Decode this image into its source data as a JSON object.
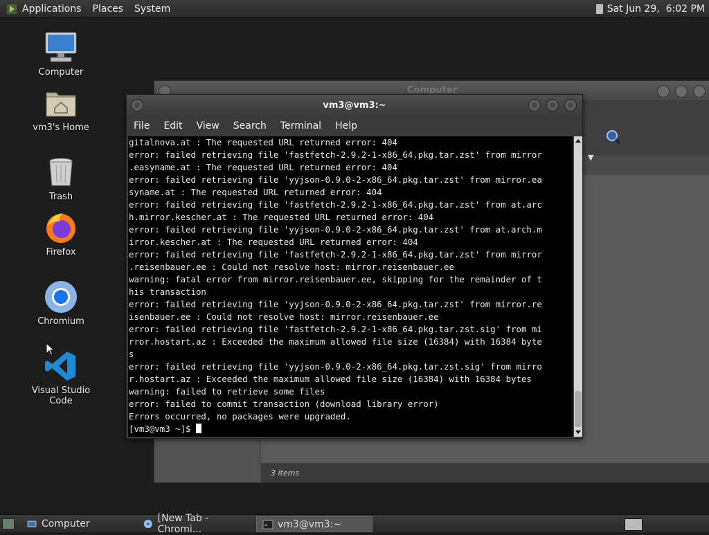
{
  "top_panel": {
    "menus": [
      "Applications",
      "Places",
      "System"
    ],
    "clock": "Sat Jun 29,  6:02 PM"
  },
  "desktop": {
    "icons": [
      {
        "label": "Computer",
        "icon": "computer-icon"
      },
      {
        "label": "vm3's Home",
        "icon": "home-folder-icon"
      },
      {
        "label": "Trash",
        "icon": "trash-icon"
      },
      {
        "label": "Firefox",
        "icon": "firefox-icon"
      },
      {
        "label": "Chromium",
        "icon": "chromium-icon"
      },
      {
        "label": "Visual Studio Code",
        "icon": "vscode-icon"
      }
    ]
  },
  "file_manager": {
    "title": "Computer",
    "status": "3 items"
  },
  "terminal": {
    "title": "vm3@vm3:~",
    "menus": [
      "File",
      "Edit",
      "View",
      "Search",
      "Terminal",
      "Help"
    ],
    "lines": [
      "gitalnova.at : The requested URL returned error: 404",
      "error: failed retrieving file 'fastfetch-2.9.2-1-x86_64.pkg.tar.zst' from mirror",
      ".easyname.at : The requested URL returned error: 404",
      "error: failed retrieving file 'yyjson-0.9.0-2-x86_64.pkg.tar.zst' from mirror.ea",
      "syname.at : The requested URL returned error: 404",
      "error: failed retrieving file 'fastfetch-2.9.2-1-x86_64.pkg.tar.zst' from at.arc",
      "h.mirror.kescher.at : The requested URL returned error: 404",
      "error: failed retrieving file 'yyjson-0.9.0-2-x86_64.pkg.tar.zst' from at.arch.m",
      "irror.kescher.at : The requested URL returned error: 404",
      "error: failed retrieving file 'fastfetch-2.9.2-1-x86_64.pkg.tar.zst' from mirror",
      ".reisenbauer.ee : Could not resolve host: mirror.reisenbauer.ee",
      "warning: fatal error from mirror.reisenbauer.ee, skipping for the remainder of t",
      "his transaction",
      "error: failed retrieving file 'yyjson-0.9.0-2-x86_64.pkg.tar.zst' from mirror.re",
      "isenbauer.ee : Could not resolve host: mirror.reisenbauer.ee",
      "error: failed retrieving file 'fastfetch-2.9.2-1-x86_64.pkg.tar.zst.sig' from mi",
      "rror.hostart.az : Exceeded the maximum allowed file size (16384) with 16384 byte",
      "s",
      "error: failed retrieving file 'yyjson-0.9.0-2-x86_64.pkg.tar.zst.sig' from mirro",
      "r.hostart.az : Exceeded the maximum allowed file size (16384) with 16384 bytes",
      "warning: failed to retrieve some files",
      "error: failed to commit transaction (download library error)",
      "Errors occurred, no packages were upgraded."
    ],
    "prompt": "[vm3@vm3 ~]$ "
  },
  "taskbar": {
    "items": [
      {
        "label": "Computer",
        "icon": "folder-icon"
      },
      {
        "label": "[New Tab - Chromi...",
        "icon": "chromium-icon"
      },
      {
        "label": "vm3@vm3:~",
        "icon": "terminal-icon"
      }
    ]
  }
}
